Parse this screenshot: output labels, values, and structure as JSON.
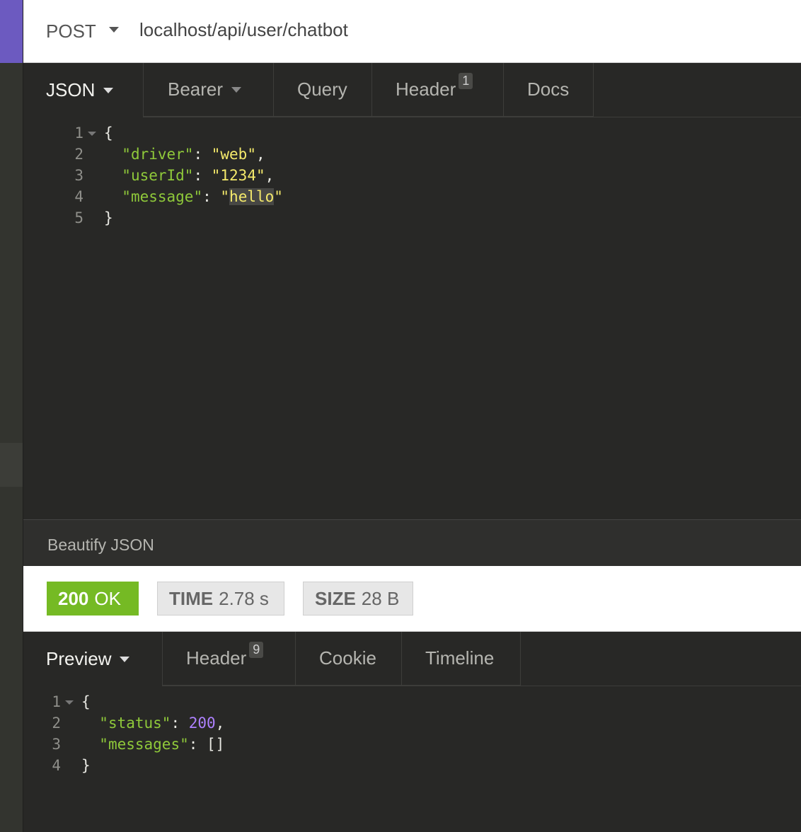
{
  "request": {
    "method": "POST",
    "url": "localhost/api/user/chatbot",
    "tabs": [
      {
        "label": "JSON"
      },
      {
        "label": "Bearer"
      },
      {
        "label": "Query"
      },
      {
        "label": "Header",
        "badge": "1"
      },
      {
        "label": "Docs"
      }
    ],
    "body_lines": [
      {
        "num": "1",
        "text": "{"
      },
      {
        "num": "2",
        "key": "\"driver\"",
        "colon": ": ",
        "value": "\"web\"",
        "tail": ","
      },
      {
        "num": "3",
        "key": "\"userId\"",
        "colon": ": ",
        "value": "\"1234\"",
        "tail": ","
      },
      {
        "num": "4",
        "key": "\"message\"",
        "colon": ": ",
        "quote_open": "\"",
        "value_highlight": "hello",
        "quote_close": "\""
      },
      {
        "num": "5",
        "text": "}"
      }
    ],
    "beautify_label": "Beautify JSON"
  },
  "response": {
    "status": {
      "code": "200",
      "text": "OK"
    },
    "time": {
      "label": "TIME",
      "value": "2.78 s"
    },
    "size": {
      "label": "SIZE",
      "value": "28 B"
    },
    "tabs": [
      {
        "label": "Preview"
      },
      {
        "label": "Header",
        "badge": "9"
      },
      {
        "label": "Cookie"
      },
      {
        "label": "Timeline"
      }
    ],
    "body_lines": [
      {
        "num": "1",
        "text": "{"
      },
      {
        "num": "2",
        "key": "\"status\"",
        "colon": ": ",
        "value": "200",
        "tail": ","
      },
      {
        "num": "3",
        "key": "\"messages\"",
        "colon": ": ",
        "plain": "[]"
      },
      {
        "num": "4",
        "text": "}"
      }
    ]
  },
  "colors": {
    "accent": "#6c5ac0",
    "status_ok": "#75ba24",
    "json_key": "#8fc93a",
    "json_string": "#f5ea6b",
    "json_number": "#ae81ff",
    "editor_bg": "#282826"
  },
  "icons": [
    "chevron-down-icon",
    "fold-arrow-icon"
  ]
}
